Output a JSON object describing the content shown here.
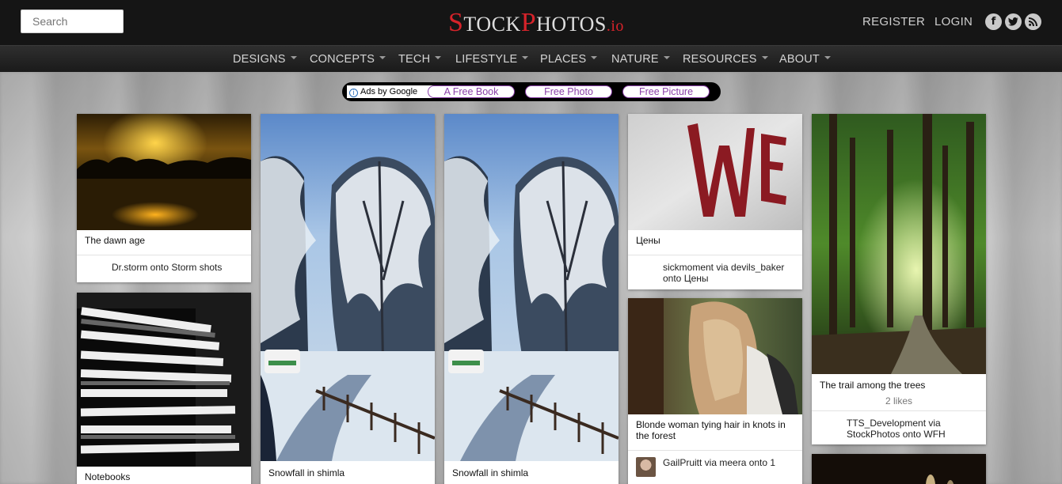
{
  "header": {
    "search_placeholder": "Search",
    "logo": {
      "s1": "S",
      "t1": "TOCK",
      "s2": "P",
      "t2": "HOTOS",
      "tld": ".io"
    },
    "register": "REGISTER",
    "login": "LOGIN",
    "social": [
      "facebook-icon",
      "twitter-icon",
      "rss-icon"
    ]
  },
  "nav": [
    "DESIGNS",
    "CONCEPTS",
    "TECH",
    "LIFESTYLE",
    "PLACES",
    "NATURE",
    "RESOURCES",
    "ABOUT"
  ],
  "ads": {
    "label": "Ads by Google",
    "links": [
      "A Free Book",
      "Free Photo",
      "Free Picture"
    ]
  },
  "pins": {
    "dawn": {
      "title": "The dawn age",
      "meta": "Dr.storm onto Storm shots"
    },
    "notebooks": {
      "title": "Notebooks"
    },
    "snow1": {
      "title": "Snowfall in shimla"
    },
    "snow2": {
      "title": "Snowfall in shimla"
    },
    "we": {
      "title": "Цены",
      "meta": "sickmoment via devils_baker onto Цены"
    },
    "blonde": {
      "title": "Blonde woman tying hair in knots in the forest",
      "meta": "GailPruitt via meera onto 1"
    },
    "trees": {
      "title": "The trail among the trees",
      "likes": "2 likes",
      "meta": "TTS_Development via StockPhotos onto WFH"
    }
  },
  "colors": {
    "brand_red": "#d6232a",
    "topbar": "#151515",
    "ad_purple": "#8a3fa8"
  }
}
